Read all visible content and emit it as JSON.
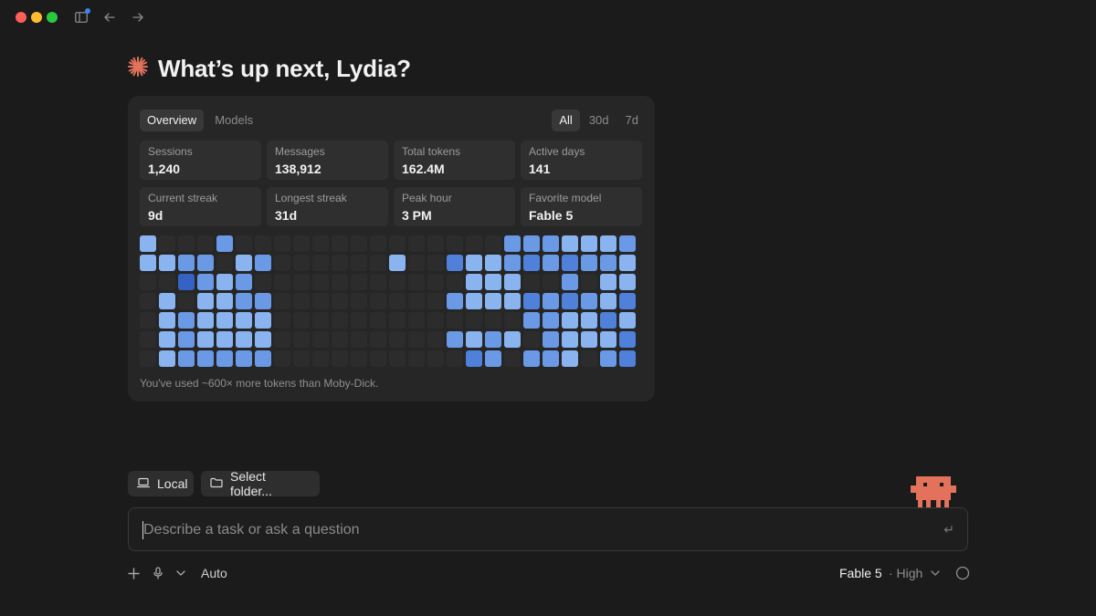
{
  "greeting": {
    "text": "What’s up next, Lydia?",
    "icon": "sparkle-asterisk-icon",
    "accent": "#e2725b"
  },
  "stats_card": {
    "tabs": [
      {
        "label": "Overview",
        "active": true
      },
      {
        "label": "Models",
        "active": false
      }
    ],
    "ranges": [
      {
        "label": "All",
        "active": true
      },
      {
        "label": "30d",
        "active": false
      },
      {
        "label": "7d",
        "active": false
      }
    ],
    "stats": [
      {
        "label": "Sessions",
        "value": "1,240"
      },
      {
        "label": "Messages",
        "value": "138,912"
      },
      {
        "label": "Total tokens",
        "value": "162.4M"
      },
      {
        "label": "Active days",
        "value": "141"
      },
      {
        "label": "Current streak",
        "value": "9d"
      },
      {
        "label": "Longest streak",
        "value": "31d"
      },
      {
        "label": "Peak hour",
        "value": "3 PM"
      },
      {
        "label": "Favorite model",
        "value": "Fable 5"
      }
    ],
    "heatmap": {
      "levels": [
        "#2c2c2c",
        "#8ab4f0",
        "#6a9ae6",
        "#4f80da",
        "#3463c4"
      ],
      "rows": [
        [
          1,
          0,
          0,
          0,
          2,
          0,
          0,
          0,
          0,
          0,
          0,
          0,
          0,
          0,
          0,
          0,
          0,
          0,
          0,
          2,
          2,
          2,
          1,
          1,
          1,
          2
        ],
        [
          1,
          1,
          2,
          2,
          0,
          1,
          2,
          0,
          0,
          0,
          0,
          0,
          0,
          1,
          0,
          0,
          3,
          1,
          1,
          2,
          3,
          2,
          3,
          2,
          2,
          1
        ],
        [
          0,
          0,
          4,
          2,
          1,
          2,
          0,
          0,
          0,
          0,
          0,
          0,
          0,
          0,
          0,
          0,
          0,
          1,
          1,
          1,
          0,
          0,
          2,
          0,
          1,
          1
        ],
        [
          0,
          1,
          0,
          1,
          1,
          2,
          2,
          0,
          0,
          0,
          0,
          0,
          0,
          0,
          0,
          0,
          2,
          1,
          1,
          1,
          3,
          2,
          3,
          2,
          1,
          3
        ],
        [
          0,
          1,
          2,
          1,
          1,
          1,
          1,
          0,
          0,
          0,
          0,
          0,
          0,
          0,
          0,
          0,
          0,
          0,
          0,
          0,
          2,
          2,
          1,
          1,
          3,
          1
        ],
        [
          0,
          1,
          2,
          1,
          1,
          1,
          1,
          0,
          0,
          0,
          0,
          0,
          0,
          0,
          0,
          0,
          2,
          1,
          2,
          1,
          0,
          2,
          1,
          1,
          1,
          3
        ],
        [
          0,
          1,
          2,
          2,
          2,
          2,
          2,
          0,
          0,
          0,
          0,
          0,
          0,
          0,
          0,
          0,
          0,
          3,
          2,
          0,
          2,
          2,
          1,
          0,
          2,
          3
        ]
      ]
    },
    "footnote": "You've used ~600× more tokens than Moby-Dick."
  },
  "chips": {
    "local": {
      "label": "Local",
      "icon": "laptop-icon"
    },
    "folder": {
      "label": "Select folder...",
      "icon": "folder-icon"
    }
  },
  "composer": {
    "placeholder": "Describe a task or ask a question",
    "value": "",
    "submit_icon": "enter-return-icon"
  },
  "bottom_bar": {
    "mode_label": "Auto",
    "model_label": "Fable 5",
    "effort_label": "· High",
    "icons": [
      "plus-icon",
      "microphone-icon",
      "chevron-down-icon",
      "chevron-down-icon",
      "circle-status-icon"
    ]
  },
  "colors": {
    "background": "#1b1b1b",
    "card": "#262626",
    "mascot": "#e2725b"
  }
}
